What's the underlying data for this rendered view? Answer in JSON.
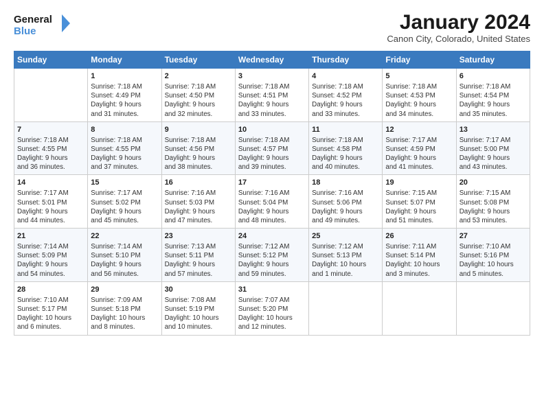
{
  "header": {
    "logo_line1": "General",
    "logo_line2": "Blue",
    "month_title": "January 2024",
    "subtitle": "Canon City, Colorado, United States"
  },
  "days_of_week": [
    "Sunday",
    "Monday",
    "Tuesday",
    "Wednesday",
    "Thursday",
    "Friday",
    "Saturday"
  ],
  "weeks": [
    [
      {
        "day": "",
        "info": ""
      },
      {
        "day": "1",
        "info": "Sunrise: 7:18 AM\nSunset: 4:49 PM\nDaylight: 9 hours\nand 31 minutes."
      },
      {
        "day": "2",
        "info": "Sunrise: 7:18 AM\nSunset: 4:50 PM\nDaylight: 9 hours\nand 32 minutes."
      },
      {
        "day": "3",
        "info": "Sunrise: 7:18 AM\nSunset: 4:51 PM\nDaylight: 9 hours\nand 33 minutes."
      },
      {
        "day": "4",
        "info": "Sunrise: 7:18 AM\nSunset: 4:52 PM\nDaylight: 9 hours\nand 33 minutes."
      },
      {
        "day": "5",
        "info": "Sunrise: 7:18 AM\nSunset: 4:53 PM\nDaylight: 9 hours\nand 34 minutes."
      },
      {
        "day": "6",
        "info": "Sunrise: 7:18 AM\nSunset: 4:54 PM\nDaylight: 9 hours\nand 35 minutes."
      }
    ],
    [
      {
        "day": "7",
        "info": "Sunrise: 7:18 AM\nSunset: 4:55 PM\nDaylight: 9 hours\nand 36 minutes."
      },
      {
        "day": "8",
        "info": "Sunrise: 7:18 AM\nSunset: 4:55 PM\nDaylight: 9 hours\nand 37 minutes."
      },
      {
        "day": "9",
        "info": "Sunrise: 7:18 AM\nSunset: 4:56 PM\nDaylight: 9 hours\nand 38 minutes."
      },
      {
        "day": "10",
        "info": "Sunrise: 7:18 AM\nSunset: 4:57 PM\nDaylight: 9 hours\nand 39 minutes."
      },
      {
        "day": "11",
        "info": "Sunrise: 7:18 AM\nSunset: 4:58 PM\nDaylight: 9 hours\nand 40 minutes."
      },
      {
        "day": "12",
        "info": "Sunrise: 7:17 AM\nSunset: 4:59 PM\nDaylight: 9 hours\nand 41 minutes."
      },
      {
        "day": "13",
        "info": "Sunrise: 7:17 AM\nSunset: 5:00 PM\nDaylight: 9 hours\nand 43 minutes."
      }
    ],
    [
      {
        "day": "14",
        "info": "Sunrise: 7:17 AM\nSunset: 5:01 PM\nDaylight: 9 hours\nand 44 minutes."
      },
      {
        "day": "15",
        "info": "Sunrise: 7:17 AM\nSunset: 5:02 PM\nDaylight: 9 hours\nand 45 minutes."
      },
      {
        "day": "16",
        "info": "Sunrise: 7:16 AM\nSunset: 5:03 PM\nDaylight: 9 hours\nand 47 minutes."
      },
      {
        "day": "17",
        "info": "Sunrise: 7:16 AM\nSunset: 5:04 PM\nDaylight: 9 hours\nand 48 minutes."
      },
      {
        "day": "18",
        "info": "Sunrise: 7:16 AM\nSunset: 5:06 PM\nDaylight: 9 hours\nand 49 minutes."
      },
      {
        "day": "19",
        "info": "Sunrise: 7:15 AM\nSunset: 5:07 PM\nDaylight: 9 hours\nand 51 minutes."
      },
      {
        "day": "20",
        "info": "Sunrise: 7:15 AM\nSunset: 5:08 PM\nDaylight: 9 hours\nand 53 minutes."
      }
    ],
    [
      {
        "day": "21",
        "info": "Sunrise: 7:14 AM\nSunset: 5:09 PM\nDaylight: 9 hours\nand 54 minutes."
      },
      {
        "day": "22",
        "info": "Sunrise: 7:14 AM\nSunset: 5:10 PM\nDaylight: 9 hours\nand 56 minutes."
      },
      {
        "day": "23",
        "info": "Sunrise: 7:13 AM\nSunset: 5:11 PM\nDaylight: 9 hours\nand 57 minutes."
      },
      {
        "day": "24",
        "info": "Sunrise: 7:12 AM\nSunset: 5:12 PM\nDaylight: 9 hours\nand 59 minutes."
      },
      {
        "day": "25",
        "info": "Sunrise: 7:12 AM\nSunset: 5:13 PM\nDaylight: 10 hours\nand 1 minute."
      },
      {
        "day": "26",
        "info": "Sunrise: 7:11 AM\nSunset: 5:14 PM\nDaylight: 10 hours\nand 3 minutes."
      },
      {
        "day": "27",
        "info": "Sunrise: 7:10 AM\nSunset: 5:16 PM\nDaylight: 10 hours\nand 5 minutes."
      }
    ],
    [
      {
        "day": "28",
        "info": "Sunrise: 7:10 AM\nSunset: 5:17 PM\nDaylight: 10 hours\nand 6 minutes."
      },
      {
        "day": "29",
        "info": "Sunrise: 7:09 AM\nSunset: 5:18 PM\nDaylight: 10 hours\nand 8 minutes."
      },
      {
        "day": "30",
        "info": "Sunrise: 7:08 AM\nSunset: 5:19 PM\nDaylight: 10 hours\nand 10 minutes."
      },
      {
        "day": "31",
        "info": "Sunrise: 7:07 AM\nSunset: 5:20 PM\nDaylight: 10 hours\nand 12 minutes."
      },
      {
        "day": "",
        "info": ""
      },
      {
        "day": "",
        "info": ""
      },
      {
        "day": "",
        "info": ""
      }
    ]
  ]
}
